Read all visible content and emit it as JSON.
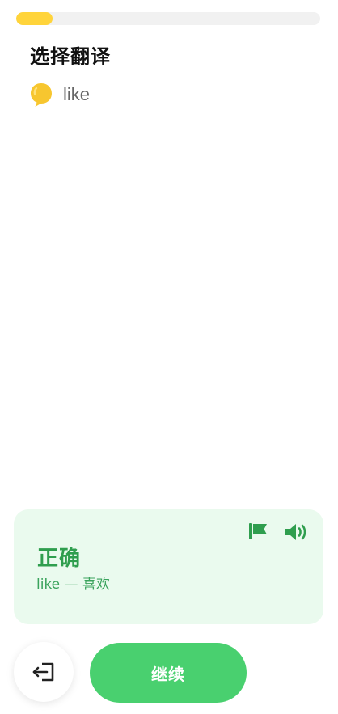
{
  "progress": {
    "fraction": 0.12,
    "fill_color": "#ffd43b",
    "track_color": "#f1f1f1"
  },
  "question": {
    "title": "选择翻译",
    "word": "like",
    "word_icon": "speech-bubble-icon"
  },
  "feedback": {
    "status": "正确",
    "detail": "like — 喜欢",
    "icons": [
      "flag-icon",
      "speaker-icon"
    ],
    "background_color": "#eafaee",
    "accent_color": "#2f9e4e"
  },
  "footer": {
    "exit_icon": "exit-icon",
    "continue_label": "继续",
    "continue_color": "#49d06f"
  }
}
